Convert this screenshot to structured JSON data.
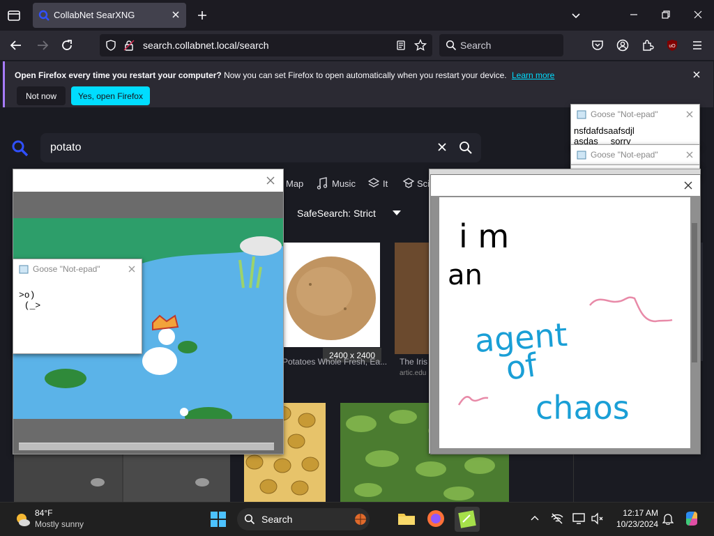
{
  "browser": {
    "tab_title": "CollabNet SearXNG",
    "url": "search.collabnet.local/search",
    "search_placeholder": "Search"
  },
  "notification": {
    "bold": "Open Firefox every time you restart your computer?",
    "text": " Now you can set Firefox to open automatically when you restart your device.",
    "link": "Learn more",
    "not_now": "Not now",
    "yes": "Yes, open Firefox"
  },
  "page": {
    "query": "potato",
    "categories": [
      "Map",
      "Music",
      "It",
      "Sci"
    ],
    "safesearch": "SafeSearch: Strict",
    "img_dims": "2400 x 2400",
    "captions": [
      "Potatoes Whole Fresh, Ea...",
      "The Iris"
    ],
    "source": "artic.edu"
  },
  "goose": {
    "title": "Goose \"Not-epad\"",
    "note1": "nsfdafdsaafsdjl\nasdas     sorry",
    "note_left": ">o)\n (_>"
  },
  "drawing": {
    "lines": [
      "i m",
      "an",
      "agent",
      "of",
      "chaos"
    ],
    "colors": {
      "ink": "#000000",
      "blue": "#1a9fd6",
      "pink": "#e88aa8"
    }
  },
  "taskbar": {
    "temp": "84°F",
    "weather": "Mostly sunny",
    "search": "Search",
    "time": "12:17 AM",
    "date": "10/23/2024"
  }
}
